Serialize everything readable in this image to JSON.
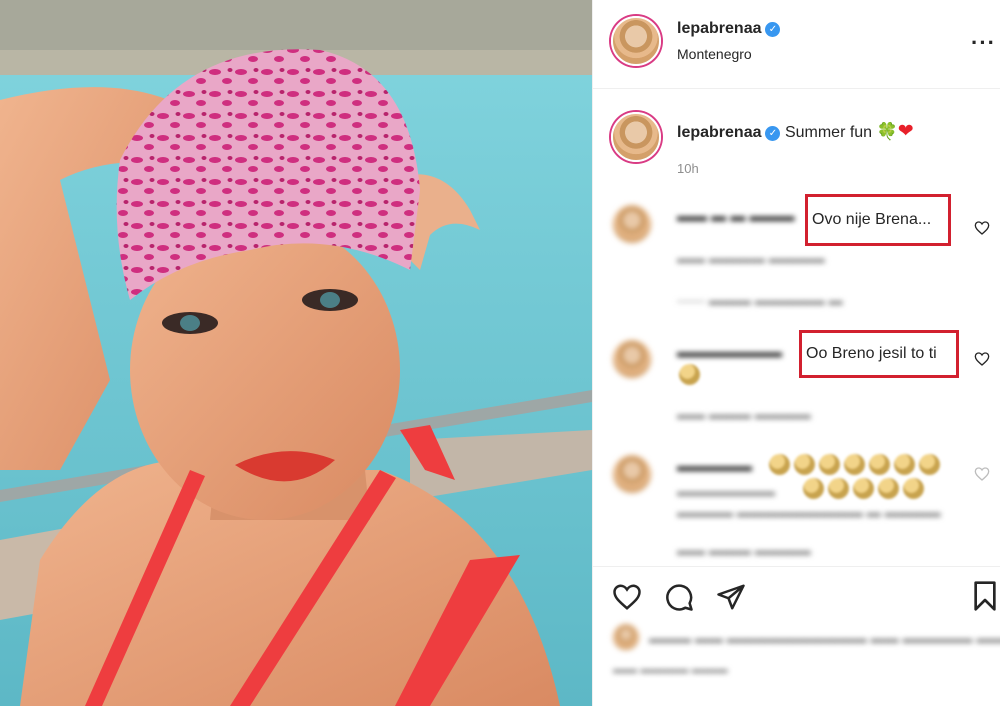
{
  "post": {
    "username": "lepabrenaa",
    "location": "Montenegro",
    "caption": "Summer fun",
    "caption_emojis": [
      "🍀",
      "❤"
    ],
    "time": "10h"
  },
  "comments": [
    {
      "highlighted_text": "Ovo nije Brena..."
    },
    {
      "highlighted_text": "Oo Breno jesil to ti"
    }
  ],
  "icons": {
    "more": "more-options-icon",
    "verified": "verified-badge-icon",
    "like": "heart-icon",
    "comment": "comment-icon",
    "share": "send-icon",
    "save": "bookmark-icon"
  },
  "colors": {
    "highlight_border": "#d2202f",
    "verified": "#3897f0",
    "story_ring": "#d93b84"
  }
}
